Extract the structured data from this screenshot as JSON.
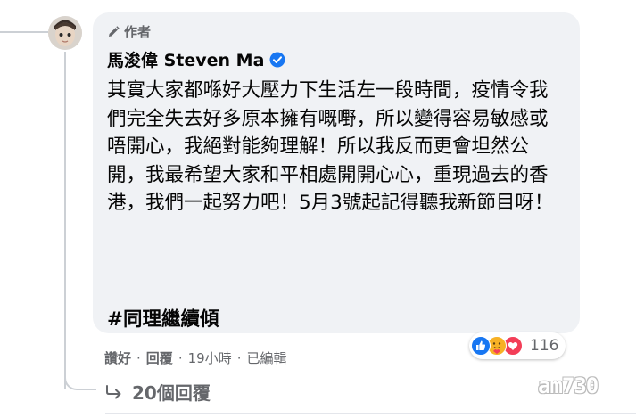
{
  "comment": {
    "author_badge": "作者",
    "author_name": "馬浚偉 Steven Ma",
    "text": "其實大家都喺好大壓力下生活左一段時間，疫情令我們完全失去好多原本擁有嘅嘢，所以變得容易敏感或唔開心，我絕對能夠理解！所以我反而更會坦然公開，我最希望大家和平相處開開心心，重現過去的香港，我們一起努力吧！5月3號起記得聽我新節目呀！",
    "hashtag": "#同理繼續傾",
    "reaction_count": "116",
    "reaction_icons": [
      "like-icon",
      "care-icon",
      "love-icon"
    ],
    "verified_icon": "verified-badge-icon",
    "pencil_icon": "pencil-icon"
  },
  "actions": {
    "like": "讚好",
    "reply": "回覆",
    "time": "19小時",
    "edited": "已編輯",
    "separator": "·"
  },
  "replies": {
    "label": "20個回覆",
    "icon": "reply-arrow-icon"
  },
  "watermark": "am730",
  "colors": {
    "bubble_bg": "#f0f2f5",
    "verified_blue": "#1877f2",
    "like_blue": "#1877f2",
    "love_red": "#f33e58",
    "care_yellow": "#f7b125",
    "secondary_text": "#65676b"
  }
}
